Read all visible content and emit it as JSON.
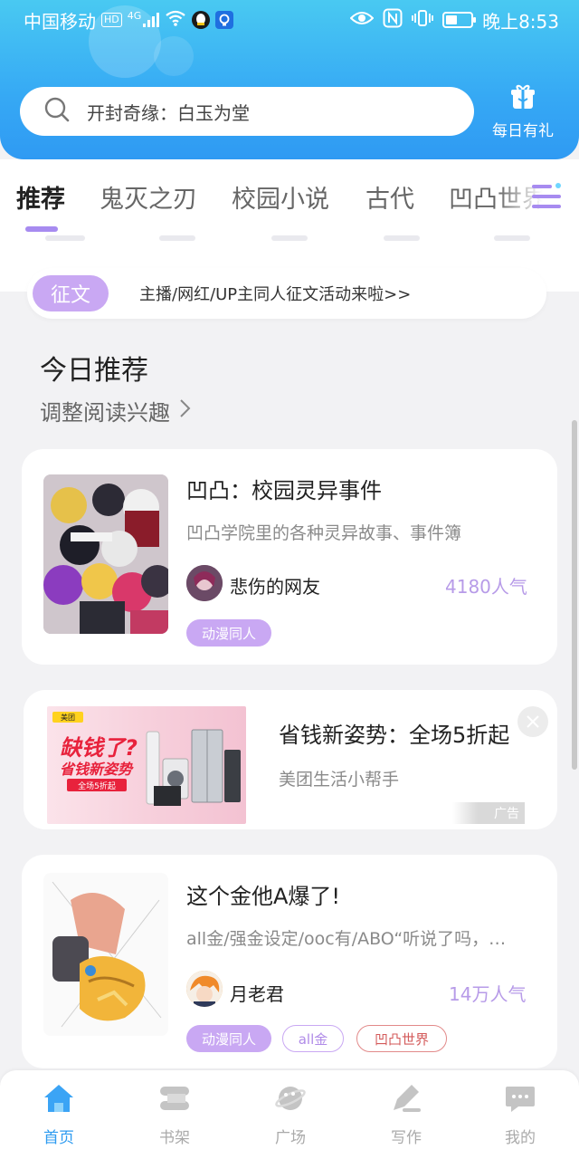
{
  "status_bar": {
    "carrier": "中国移动",
    "hd": "HD",
    "net": "4G",
    "time": "晚上8:53"
  },
  "search": {
    "text": "开封奇缘：白玉为堂"
  },
  "daily_gift": {
    "label": "每日有礼"
  },
  "tabs": [
    {
      "label": "推荐",
      "active": true
    },
    {
      "label": "鬼灭之刃",
      "active": false
    },
    {
      "label": "校园小说",
      "active": false
    },
    {
      "label": "古代",
      "active": false
    },
    {
      "label": "凹凸世界",
      "active": false
    }
  ],
  "contest": {
    "tag": "征文",
    "text": "主播/网红/UP主同人征文活动来啦>>"
  },
  "section": {
    "title": "今日推荐",
    "subtitle": "调整阅读兴趣"
  },
  "books": [
    {
      "title": "凹凸：校园灵异事件",
      "desc": "凹凸学院里的各种灵异故事、事件簿",
      "author": "悲伤的网友",
      "popularity": "4180人气",
      "tags": [
        "动漫同人"
      ]
    },
    {
      "title": "这个金他A爆了!",
      "desc": "all金/强金设定/ooc有/ABO“听说了吗，…",
      "author": "月老君",
      "popularity": "14万人气",
      "tags": [
        "动漫同人",
        "all金",
        "凹凸世界"
      ]
    }
  ],
  "ad": {
    "title": "省钱新姿势：全场5折起",
    "source": "美团生活小帮手",
    "badge": "广告",
    "banner": {
      "brand": "美团",
      "headline1": "缺钱了?",
      "headline2": "省钱新姿势",
      "promo": "全场5折起"
    }
  },
  "bottom_nav": [
    {
      "label": "首页",
      "icon": "home-icon",
      "active": true
    },
    {
      "label": "书架",
      "icon": "bookshelf-icon",
      "active": false
    },
    {
      "label": "广场",
      "icon": "planet-icon",
      "active": false
    },
    {
      "label": "写作",
      "icon": "pen-icon",
      "active": false
    },
    {
      "label": "我的",
      "icon": "chat-bubble-icon",
      "active": false
    }
  ],
  "colors": {
    "header_gradient_top": "#49c9f2",
    "header_gradient_bottom": "#2f9af3",
    "accent_purple": "#c9a8f3",
    "nav_active": "#2e9bf0"
  }
}
